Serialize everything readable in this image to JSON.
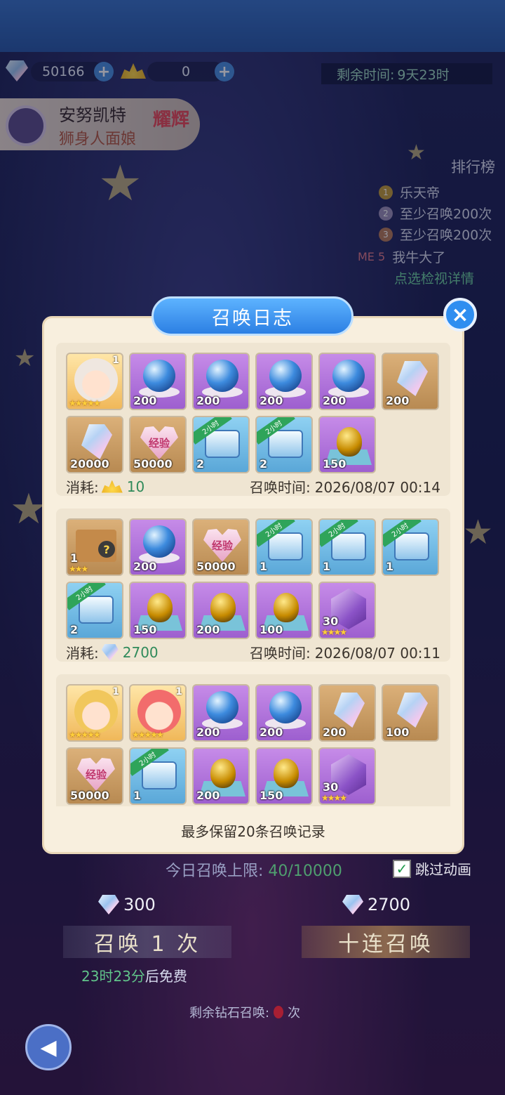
{
  "resources": {
    "diamond_amount": "50166",
    "coin_amount": "0"
  },
  "timer": {
    "label": "剩余时间:",
    "value": "9天23时"
  },
  "hero": {
    "name": "安努凯特",
    "subtitle": "狮身人面娘",
    "badge": "耀辉"
  },
  "ranking": {
    "title": "排行榜",
    "entries": [
      "乐天帝",
      "至少召唤200次",
      "至少召唤200次"
    ],
    "me": "我牛大了",
    "me_rank_label": "ME 5",
    "details_link": "点选检视详情"
  },
  "modal": {
    "title": "召唤日志",
    "close": "×",
    "footer": "最多保留20条召唤记录",
    "records": [
      {
        "cost_label": "消耗:",
        "cost_value": "10",
        "time_label": "召唤时间:",
        "time_value": "2026/08/07 00:14",
        "items": [
          {
            "type": "character",
            "qty": "1",
            "stars": "★★★★★"
          },
          {
            "type": "orb",
            "qty": "200"
          },
          {
            "type": "orb",
            "qty": "200"
          },
          {
            "type": "orb",
            "qty": "200"
          },
          {
            "type": "orb",
            "qty": "200"
          },
          {
            "type": "crystal",
            "qty": "200"
          },
          {
            "type": "crystal",
            "qty": "20000"
          },
          {
            "type": "exp-heart",
            "qty": "50000",
            "label": "经验"
          },
          {
            "type": "chest",
            "qty": "2",
            "ribbon": "2小时"
          },
          {
            "type": "chest",
            "qty": "2",
            "ribbon": "2小时"
          },
          {
            "type": "egg",
            "qty": "150"
          }
        ]
      },
      {
        "cost_label": "消耗:",
        "cost_value": "2700",
        "time_label": "召唤时间:",
        "time_value": "2026/08/07 00:11",
        "items": [
          {
            "type": "mystery-box",
            "qty": "1",
            "stars": "★★★",
            "mark": "?"
          },
          {
            "type": "orb",
            "qty": "200"
          },
          {
            "type": "exp-heart",
            "qty": "50000",
            "label": "经验"
          },
          {
            "type": "chest",
            "qty": "1",
            "ribbon": "2小时"
          },
          {
            "type": "chest",
            "qty": "1",
            "ribbon": "2小时"
          },
          {
            "type": "chest",
            "qty": "1",
            "ribbon": "2小时"
          },
          {
            "type": "chest",
            "qty": "2",
            "ribbon": "2小时"
          },
          {
            "type": "egg",
            "qty": "150"
          },
          {
            "type": "egg",
            "qty": "200"
          },
          {
            "type": "egg",
            "qty": "100"
          },
          {
            "type": "prism",
            "qty": "30",
            "stars": "★★★★"
          }
        ]
      },
      {
        "items": [
          {
            "type": "character",
            "qty": "1",
            "stars": "★★★★★"
          },
          {
            "type": "character",
            "qty": "1",
            "stars": "★★★★★"
          },
          {
            "type": "orb",
            "qty": "200"
          },
          {
            "type": "orb",
            "qty": "200"
          },
          {
            "type": "crystal",
            "qty": "200"
          },
          {
            "type": "crystal",
            "qty": "100"
          },
          {
            "type": "exp-heart",
            "qty": "50000",
            "label": "经验"
          },
          {
            "type": "chest",
            "qty": "1",
            "ribbon": "2小时"
          },
          {
            "type": "egg",
            "qty": "200"
          },
          {
            "type": "egg",
            "qty": "150"
          },
          {
            "type": "prism",
            "qty": "30",
            "stars": "★★★★"
          }
        ]
      }
    ]
  },
  "summon": {
    "daily_limit_label": "今日召唤上限:",
    "daily_limit_value": "40/10000",
    "skip_label": "跳过动画",
    "single_cost": "300",
    "ten_cost": "2700",
    "single_label": "召唤 1 次",
    "ten_label": "十连召唤",
    "free_time": "23时23分",
    "free_suffix": "后免费",
    "remaining_label": "剩余钻石召唤:",
    "remaining_suffix": "次"
  }
}
